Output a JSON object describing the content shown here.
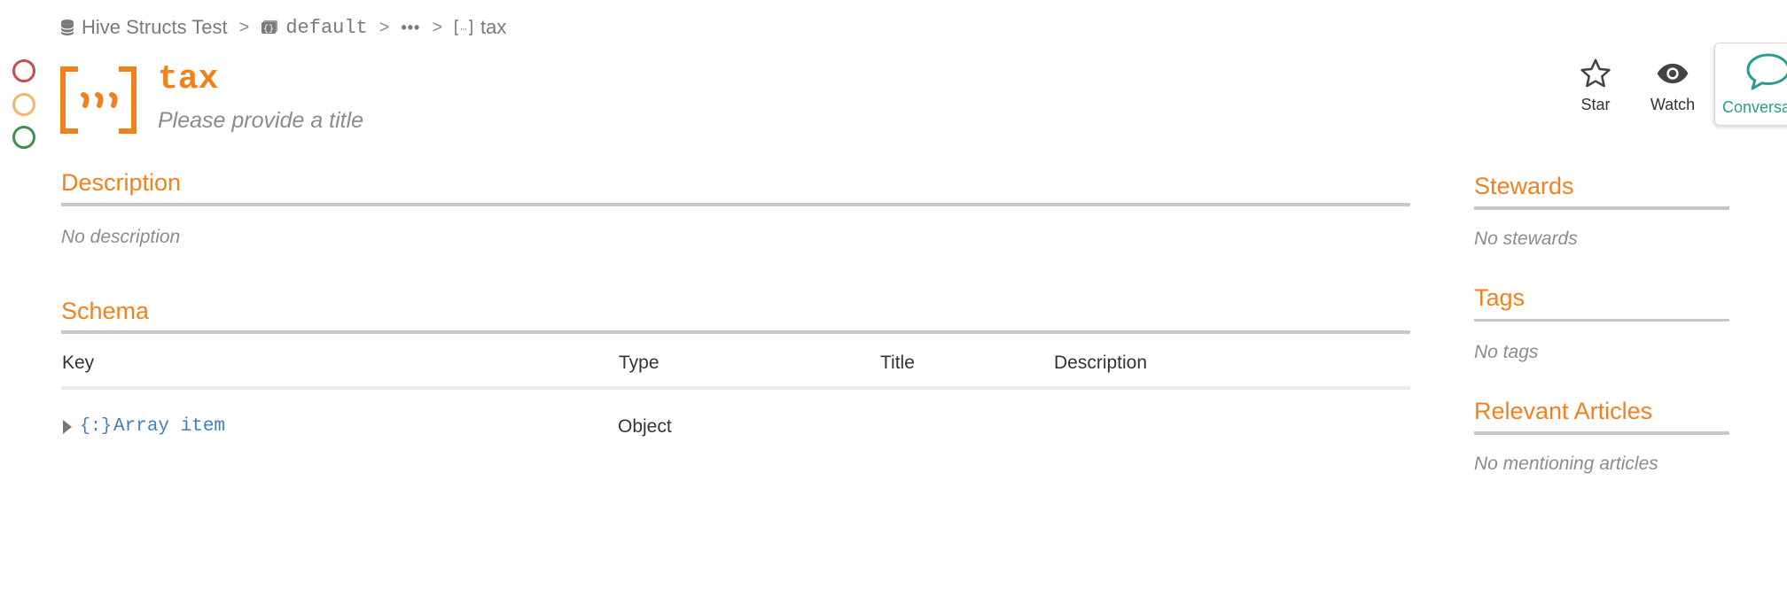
{
  "breadcrumb": {
    "database": "Hive Structs Test",
    "schema": "default",
    "ellipsis": "•••",
    "current": "tax"
  },
  "status": {
    "circles": [
      "red",
      "yellow",
      "green"
    ],
    "colors": [
      "#c44d4d",
      "#f4b56a",
      "#3f8f4f"
    ]
  },
  "header": {
    "icon": "array-brackets-icon",
    "title": "tax",
    "subtitle": "Please provide a title"
  },
  "actions": {
    "star": "Star",
    "watch": "Watch",
    "conversations": "Conversations"
  },
  "main": {
    "description": {
      "heading": "Description",
      "empty": "No description"
    },
    "schema": {
      "heading": "Schema",
      "columns": [
        "Key",
        "Type",
        "Title",
        "Description"
      ],
      "rows": [
        {
          "key": "Array item",
          "type": "Object",
          "title": "",
          "description": "",
          "icon": "object-braces-icon",
          "expanded": false
        }
      ]
    }
  },
  "sidebar": {
    "stewards": {
      "heading": "Stewards",
      "empty": "No stewards"
    },
    "tags": {
      "heading": "Tags",
      "empty": "No tags"
    },
    "articles": {
      "heading": "Relevant Articles",
      "empty": "No mentioning articles"
    }
  },
  "colors": {
    "accent": "#f0821e",
    "link": "#3d7fbf",
    "conversation": "#2a9d8f"
  }
}
